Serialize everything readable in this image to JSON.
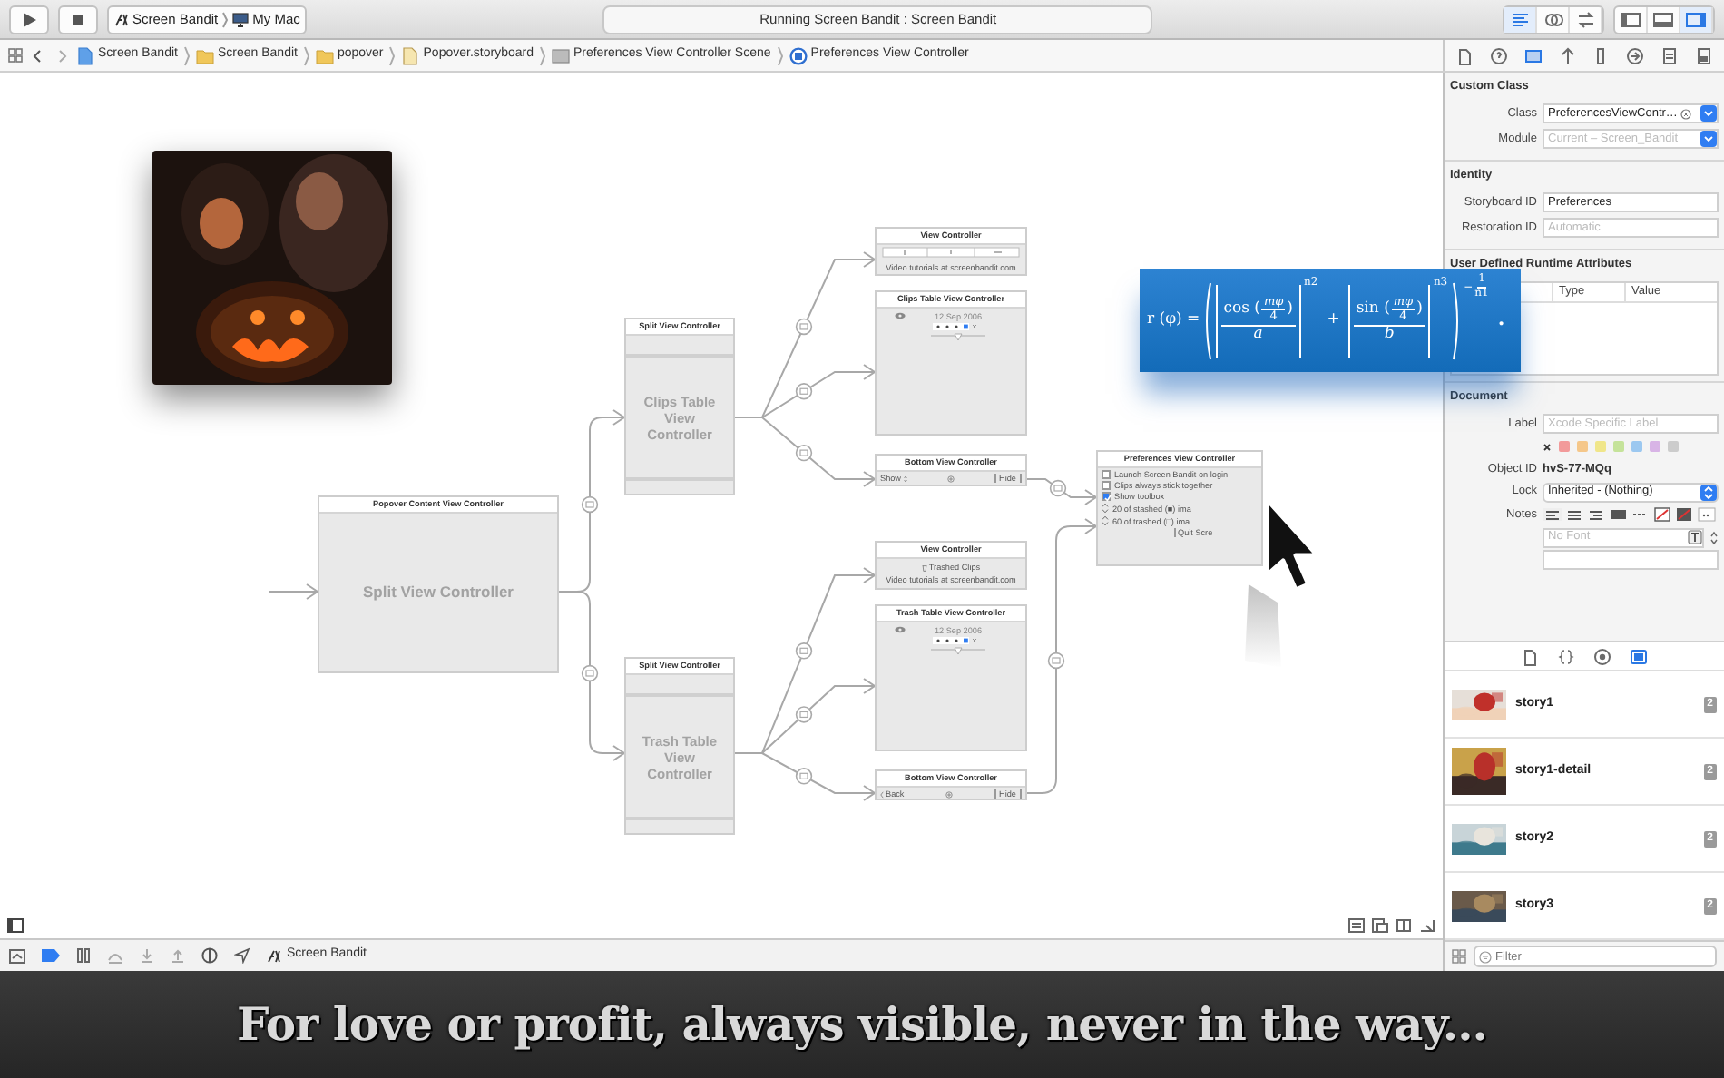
{
  "toolbar": {
    "scheme": "Screen Bandit",
    "destination": "My Mac",
    "activity": "Running Screen Bandit : Screen Bandit",
    "editor_modes": [
      {
        "selected": true
      },
      {
        "selected": false
      },
      {
        "selected": false
      }
    ],
    "panels": [
      {
        "selected": false
      },
      {
        "selected": false
      },
      {
        "selected": true
      }
    ]
  },
  "jump_bar": {
    "path": [
      {
        "kind": "project",
        "label": "Screen Bandit"
      },
      {
        "kind": "folder",
        "label": "Screen Bandit"
      },
      {
        "kind": "folder",
        "label": "popover"
      },
      {
        "kind": "storyboard",
        "label": "Popover.storyboard"
      },
      {
        "kind": "scene",
        "label": "Preferences View Controller Scene"
      },
      {
        "kind": "controller",
        "label": "Preferences View Controller"
      }
    ]
  },
  "inspector_tabs": [
    {
      "selected": false
    },
    {
      "selected": false
    },
    {
      "selected": true
    },
    {
      "selected": false
    },
    {
      "selected": false
    },
    {
      "selected": false
    },
    {
      "selected": false
    },
    {
      "selected": false
    }
  ],
  "canvas": {
    "scenes": [
      {
        "kind": "placeholder",
        "title": "Popover Content View Controller",
        "label": "Split View Controller"
      },
      {
        "kind": "split",
        "title": "Split View Controller",
        "label": "Clips Table View Controller"
      },
      {
        "kind": "split",
        "title": "Split View Controller",
        "label": "Trash Table View Controller"
      },
      {
        "kind": "segmented",
        "title": "View Controller",
        "footer": "Video tutorials at screenbandit.com"
      },
      {
        "kind": "table",
        "title": "Clips Table View Controller",
        "date": "12 Sep 2006"
      },
      {
        "kind": "toolbar_stepper",
        "title": "Bottom View Controller",
        "left": "Show",
        "right": "Hide"
      },
      {
        "kind": "trash_header",
        "title": "View Controller",
        "label": "Trashed Clips",
        "footer": "Video tutorials at screenbandit.com"
      },
      {
        "kind": "table",
        "title": "Trash Table View Controller",
        "date": "12 Sep 2006"
      },
      {
        "kind": "toolbar_back",
        "title": "Bottom View Controller",
        "left": "Back",
        "right": "Hide"
      },
      {
        "kind": "prefs",
        "title": "Preferences View Controller",
        "options": [
          {
            "label": "Launch Screen Bandit on login",
            "checked": false
          },
          {
            "label": "Clips always stick together",
            "checked": false
          },
          {
            "label": "Show toolbox",
            "checked": true
          }
        ],
        "steppers": [
          "20 of stashed (■) ima",
          "60 of trashed (□) ima"
        ],
        "button": "Quit Scre"
      }
    ]
  },
  "formula": {
    "lhs": "r (φ) =",
    "terms": [
      {
        "fn_open": "cos (",
        "arg_num": "mφ",
        "arg_den": "4",
        "fn_close": ")",
        "den": "a",
        "power": "n2"
      },
      {
        "fn_open": "sin (",
        "arg_num": "mφ",
        "arg_den": "4",
        "fn_close": ")",
        "den": "b",
        "power": "n3"
      }
    ],
    "operator": "+",
    "outer_power": {
      "sign": "−",
      "num": "1",
      "den": "n1"
    },
    "end": "."
  },
  "inspector": {
    "custom_class": {
      "title": "Custom Class",
      "class_label": "Class",
      "class_value": "PreferencesViewContr…",
      "module_label": "Module",
      "module_placeholder": "Current – Screen_Bandit"
    },
    "identity": {
      "title": "Identity",
      "storyboard_id_label": "Storyboard ID",
      "storyboard_id": "Preferences",
      "restoration_id_label": "Restoration ID",
      "restoration_id_placeholder": "Automatic"
    },
    "runtime_attributes": {
      "title": "User Defined Runtime Attributes",
      "columns": [
        "Type",
        "Value"
      ]
    },
    "document": {
      "title": "Document",
      "label_label": "Label",
      "label_placeholder": "Xcode Specific Label",
      "label_colors": [
        {
          "color": "#f29a9a"
        },
        {
          "color": "#f5c78a"
        },
        {
          "color": "#f0e68a"
        },
        {
          "color": "#c5e39a"
        },
        {
          "color": "#9cc8f0"
        },
        {
          "color": "#d8b4e6"
        },
        {
          "color": "#cccccc"
        }
      ],
      "object_id_label": "Object ID",
      "object_id": "hvS-77-MQq",
      "lock_label": "Lock",
      "lock_value": "Inherited - (Nothing)",
      "notes_label": "Notes",
      "font_placeholder": "No Font"
    }
  },
  "library": {
    "tabs": [
      {
        "selected": false
      },
      {
        "selected": false
      },
      {
        "selected": false
      },
      {
        "selected": true
      }
    ],
    "items": [
      {
        "title": "story1",
        "count": "2"
      },
      {
        "title": "story1-detail",
        "count": "2"
      },
      {
        "title": "story2",
        "count": "2"
      },
      {
        "title": "story3",
        "count": "2"
      }
    ],
    "filter_placeholder": "Filter"
  },
  "debug_bar": {
    "breakpoints_active": true,
    "process": "Screen Bandit"
  },
  "caption": "For love or profit, always visible, never in the way..."
}
